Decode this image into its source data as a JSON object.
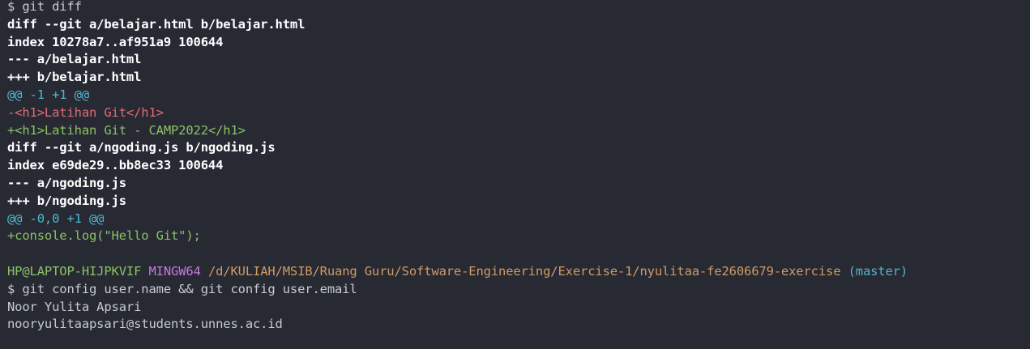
{
  "terminal": {
    "cmd1": "$ git diff",
    "diff1": {
      "header": "diff --git a/belajar.html b/belajar.html",
      "index": "index 10278a7..af951a9 100644",
      "old_file": "--- a/belajar.html",
      "new_file": "+++ b/belajar.html",
      "hunk": "@@ -1 +1 @@",
      "removed": "-<h1>Latihan Git</h1>",
      "added": "+<h1>Latihan Git - CAMP2022</h1>"
    },
    "diff2": {
      "header": "diff --git a/ngoding.js b/ngoding.js",
      "index": "index e69de29..bb8ec33 100644",
      "old_file": "--- a/ngoding.js",
      "new_file": "+++ b/ngoding.js",
      "hunk": "@@ -0,0 +1 @@",
      "added": "+console.log(\"Hello Git\");"
    },
    "prompt": {
      "user_host": "HP@LAPTOP-HIJPKVIF",
      "system": "MINGW64",
      "path": "/d/KULIAH/MSIB/Ruang Guru/Software-Engineering/Exercise-1/nyulitaa-fe2606679-exercise",
      "branch": "(master)"
    },
    "cmd2": "$ git config user.name && git config user.email",
    "output_name": "Noor Yulita Apsari",
    "output_email": "nooryulitaapsari@students.unnes.ac.id"
  },
  "colors": {
    "background": "#272a33",
    "text": "#c5cad3",
    "hunk": "#4fb5cf",
    "removed": "#e06c75",
    "added": "#8cc265",
    "system": "#c678dd",
    "path": "#d19a66"
  }
}
